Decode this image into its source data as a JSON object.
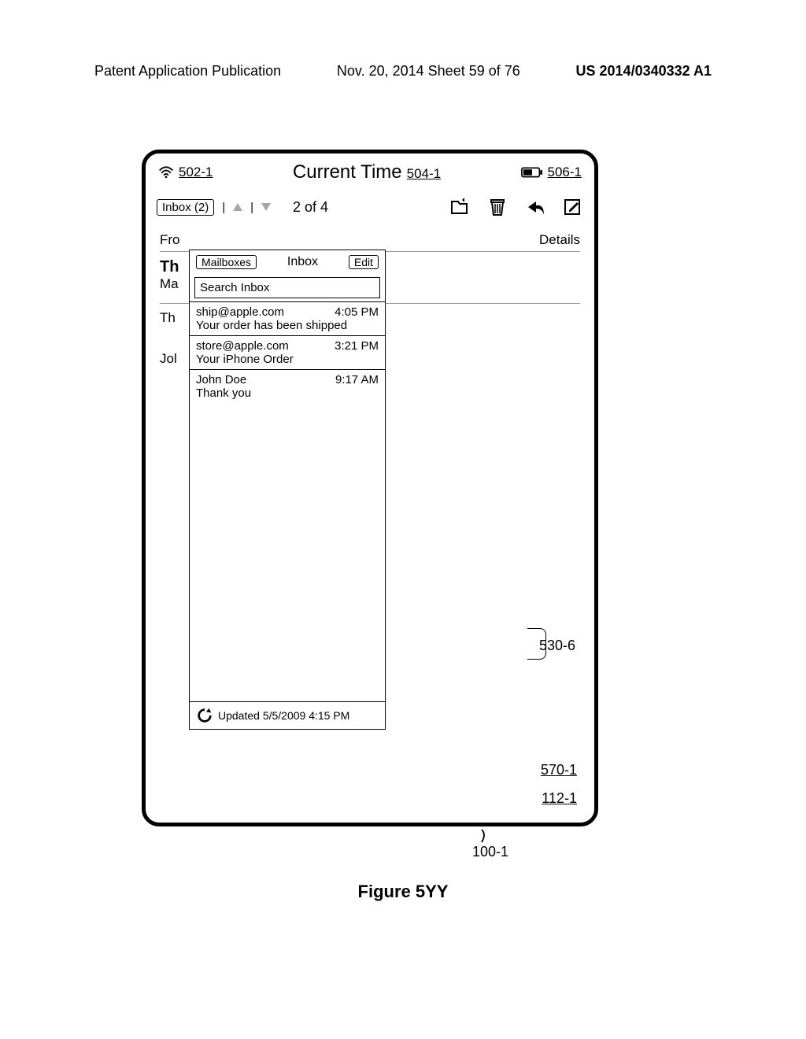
{
  "doc_header": {
    "left": "Patent Application Publication",
    "center": "Nov. 20, 2014  Sheet 59 of 76",
    "right": "US 2014/0340332 A1"
  },
  "status": {
    "ref_left": "502-1",
    "center_title": "Current Time",
    "ref_center": "504-1",
    "ref_right": "506-1"
  },
  "toolbar": {
    "inbox_label": "Inbox (2)",
    "counter": "2 of 4"
  },
  "from": {
    "label": "Fro",
    "details": "Details"
  },
  "bg": {
    "row1a": "Th",
    "row1b": "Ma",
    "row2": "Th",
    "row3": "Jol"
  },
  "popover": {
    "mailboxes": "Mailboxes",
    "title": "Inbox",
    "edit": "Edit",
    "search_placeholder": "Search Inbox",
    "items": [
      {
        "sender": "ship@apple.com",
        "time": "4:05 PM",
        "subject": "Your order has been shipped"
      },
      {
        "sender": "store@apple.com",
        "time": "3:21 PM",
        "subject": "Your iPhone Order"
      },
      {
        "sender": "John Doe",
        "time": "9:17 AM",
        "subject": "Thank you"
      }
    ],
    "footer": "Updated 5/5/2009 4:15 PM"
  },
  "annotations": {
    "a530": "530-6",
    "a570": "570-1",
    "a112": "112-1",
    "a100": "100-1"
  },
  "figure_caption": "Figure 5YY"
}
